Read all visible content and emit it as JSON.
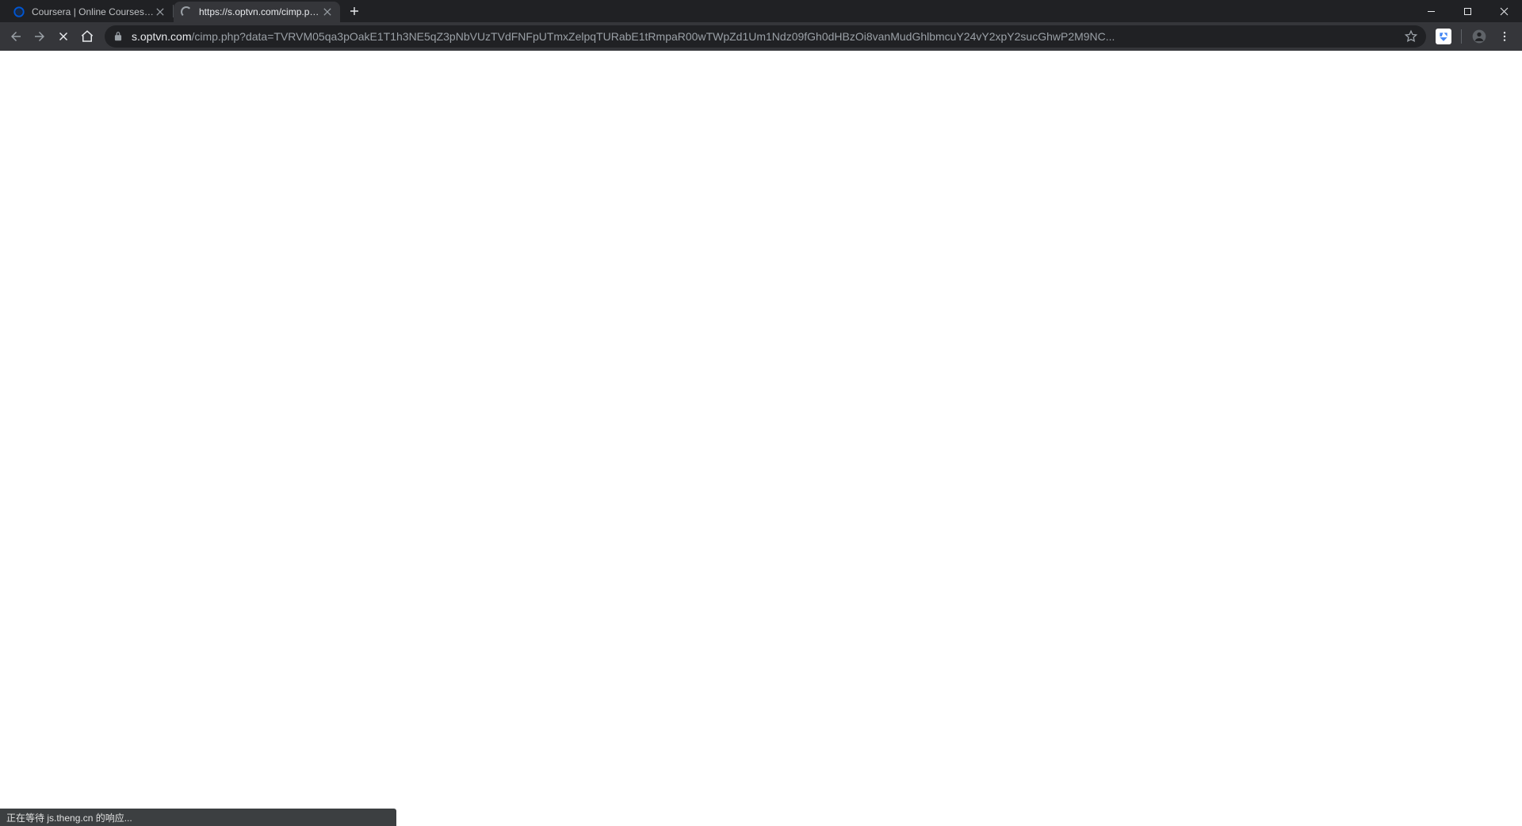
{
  "tabs": [
    {
      "title": "Coursera | Online Courses & Credentials",
      "active": false
    },
    {
      "title": "https://s.optvn.com/cimp.php?data=",
      "active": true
    }
  ],
  "address": {
    "domain": "s.optvn.com",
    "path": "/cimp.php?data=TVRVM05qa3pOakE1T1h3NE5qZ3pNbVUzTVdFNFpUTmxZelpqTURabE1tRmpaR00wTWpZd1Um1Ndz09fGh0dHBzOi8vanMudGhlbmcuY24vY2xpY2sucGhwP2M9NC..."
  },
  "status_text": "正在等待 js.theng.cn 的响应..."
}
